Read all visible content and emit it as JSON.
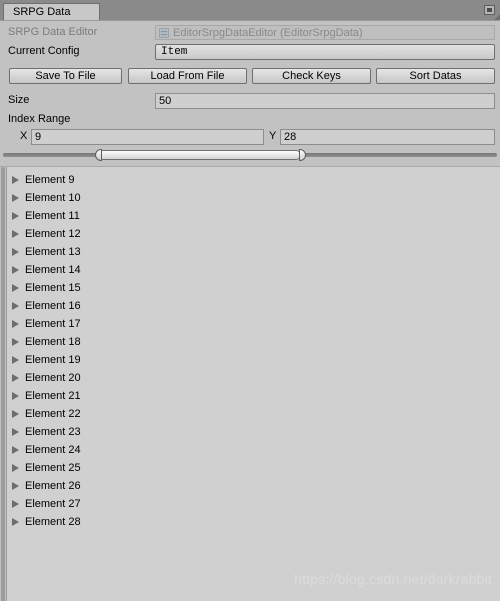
{
  "window": {
    "tab_label": "SRPG Data",
    "panel_menu_icon": "panel-menu-icon",
    "background_color": "#c2c2c2",
    "chrome_color": "#8a8a8a"
  },
  "fields": {
    "editor_label": "SRPG Data Editor",
    "editor_value": "EditorSrpgDataEditor (EditorSrpgData)",
    "config_label": "Current Config",
    "config_value": "Item",
    "size_label": "Size",
    "size_value": "50",
    "index_range_label": "Index Range",
    "x_label": "X",
    "x_value": "9",
    "y_label": "Y",
    "y_value": "28"
  },
  "toolbar": {
    "buttons": [
      {
        "label": "Save To File"
      },
      {
        "label": "Load From File"
      },
      {
        "label": "Check Keys"
      },
      {
        "label": "Sort Datas"
      }
    ]
  },
  "slider": {
    "min_value": 9,
    "max_value": 28,
    "range_min": 0,
    "range_max": 49,
    "left_percent": 18.4,
    "right_percent": 57.1
  },
  "list": {
    "items": [
      {
        "label": "Element 9"
      },
      {
        "label": "Element 10"
      },
      {
        "label": "Element 11"
      },
      {
        "label": "Element 12"
      },
      {
        "label": "Element 13"
      },
      {
        "label": "Element 14"
      },
      {
        "label": "Element 15"
      },
      {
        "label": "Element 16"
      },
      {
        "label": "Element 17"
      },
      {
        "label": "Element 18"
      },
      {
        "label": "Element 19"
      },
      {
        "label": "Element 20"
      },
      {
        "label": "Element 21"
      },
      {
        "label": "Element 22"
      },
      {
        "label": "Element 23"
      },
      {
        "label": "Element 24"
      },
      {
        "label": "Element 25"
      },
      {
        "label": "Element 26"
      },
      {
        "label": "Element 27"
      },
      {
        "label": "Element 28"
      }
    ]
  },
  "watermark": {
    "text": "https://blog.csdn.net/darkrabbit"
  }
}
